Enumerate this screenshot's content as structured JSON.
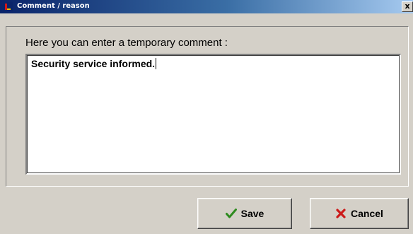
{
  "window": {
    "title": "Comment / reason",
    "title_icon": "app-icon",
    "close_label": "x",
    "close_icon": "close-icon"
  },
  "form": {
    "prompt": "Here you can enter a temporary comment :",
    "comment_value": "Security service informed."
  },
  "buttons": {
    "save_label": "Save",
    "save_icon": "checkmark-icon",
    "cancel_label": "Cancel",
    "cancel_icon": "x-mark-icon"
  },
  "colors": {
    "titlebar_start": "#0a246a",
    "titlebar_end": "#a6caf0",
    "face": "#d4d0c8",
    "save_check": "#2e8b1f",
    "cancel_x": "#cc1a1a"
  }
}
